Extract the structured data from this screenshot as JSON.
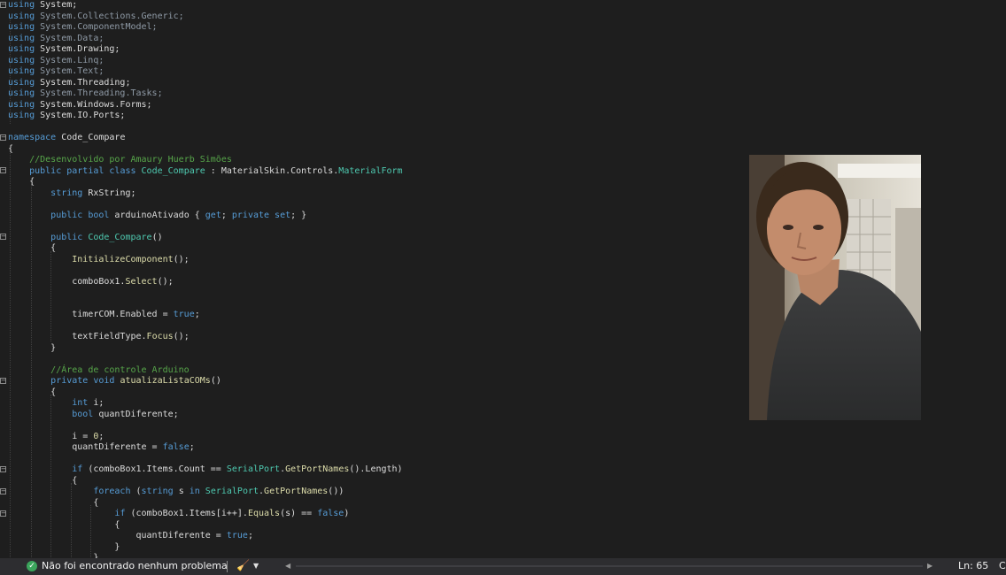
{
  "code_lines": [
    [
      [
        "kw",
        "using "
      ],
      [
        "id",
        "System;"
      ]
    ],
    [
      [
        "kw",
        "using "
      ],
      [
        "dim",
        "System.Collections.Generic;"
      ]
    ],
    [
      [
        "kw",
        "using "
      ],
      [
        "dim",
        "System.ComponentModel;"
      ]
    ],
    [
      [
        "kw",
        "using "
      ],
      [
        "dim",
        "System.Data;"
      ]
    ],
    [
      [
        "kw",
        "using "
      ],
      [
        "id",
        "System.Drawing;"
      ]
    ],
    [
      [
        "kw",
        "using "
      ],
      [
        "dim",
        "System.Linq;"
      ]
    ],
    [
      [
        "kw",
        "using "
      ],
      [
        "dim",
        "System.Text;"
      ]
    ],
    [
      [
        "kw",
        "using "
      ],
      [
        "id",
        "System.Threading;"
      ]
    ],
    [
      [
        "kw",
        "using "
      ],
      [
        "dim",
        "System.Threading.Tasks;"
      ]
    ],
    [
      [
        "kw",
        "using "
      ],
      [
        "id",
        "System.Windows.Forms;"
      ]
    ],
    [
      [
        "kw",
        "using "
      ],
      [
        "id",
        "System.IO.Ports;"
      ]
    ],
    [],
    [
      [
        "kw",
        "namespace "
      ],
      [
        "id",
        "Code_Compare"
      ]
    ],
    [
      [
        "id",
        "{"
      ]
    ],
    [
      [
        "id",
        "    "
      ],
      [
        "cm",
        "//Desenvolvido por Amaury Huerb Simões"
      ]
    ],
    [
      [
        "id",
        "    "
      ],
      [
        "kw",
        "public partial class "
      ],
      [
        "ty",
        "Code_Compare"
      ],
      [
        "id",
        " : MaterialSkin.Controls."
      ],
      [
        "ty",
        "MaterialForm"
      ]
    ],
    [
      [
        "id",
        "    {"
      ]
    ],
    [
      [
        "id",
        "        "
      ],
      [
        "kw",
        "string "
      ],
      [
        "id",
        "RxString;"
      ]
    ],
    [],
    [
      [
        "id",
        "        "
      ],
      [
        "kw",
        "public bool "
      ],
      [
        "id",
        "arduinoAtivado { "
      ],
      [
        "kw",
        "get"
      ],
      [
        "id",
        "; "
      ],
      [
        "kw",
        "private set"
      ],
      [
        "id",
        "; }"
      ]
    ],
    [],
    [
      [
        "id",
        "        "
      ],
      [
        "kw",
        "public "
      ],
      [
        "ty",
        "Code_Compare"
      ],
      [
        "id",
        "()"
      ]
    ],
    [
      [
        "id",
        "        {"
      ]
    ],
    [
      [
        "id",
        "            "
      ],
      [
        "me",
        "InitializeComponent"
      ],
      [
        "id",
        "();"
      ]
    ],
    [],
    [
      [
        "id",
        "            comboBox1."
      ],
      [
        "me",
        "Select"
      ],
      [
        "id",
        "();"
      ]
    ],
    [],
    [],
    [
      [
        "id",
        "            timerCOM.Enabled = "
      ],
      [
        "kw",
        "true"
      ],
      [
        "id",
        ";"
      ]
    ],
    [],
    [
      [
        "id",
        "            textFieldType."
      ],
      [
        "me",
        "Focus"
      ],
      [
        "id",
        "();"
      ]
    ],
    [
      [
        "id",
        "        }"
      ]
    ],
    [],
    [
      [
        "id",
        "        "
      ],
      [
        "cm",
        "//Área de controle Arduino"
      ]
    ],
    [
      [
        "id",
        "        "
      ],
      [
        "kw",
        "private void "
      ],
      [
        "me",
        "atualizaListaCOMs"
      ],
      [
        "id",
        "()"
      ]
    ],
    [
      [
        "id",
        "        {"
      ]
    ],
    [
      [
        "id",
        "            "
      ],
      [
        "kw",
        "int "
      ],
      [
        "id",
        "i;"
      ]
    ],
    [
      [
        "id",
        "            "
      ],
      [
        "kw",
        "bool "
      ],
      [
        "id",
        "quantDiferente;"
      ]
    ],
    [],
    [
      [
        "id",
        "            i = "
      ],
      [
        "me",
        "0"
      ],
      [
        "id",
        ";"
      ]
    ],
    [
      [
        "id",
        "            quantDiferente = "
      ],
      [
        "kw",
        "false"
      ],
      [
        "id",
        ";"
      ]
    ],
    [],
    [
      [
        "id",
        "            "
      ],
      [
        "kw",
        "if "
      ],
      [
        "id",
        "(comboBox1.Items.Count == "
      ],
      [
        "ty",
        "SerialPort"
      ],
      [
        "id",
        "."
      ],
      [
        "me",
        "GetPortNames"
      ],
      [
        "id",
        "().Length)"
      ]
    ],
    [
      [
        "id",
        "            {"
      ]
    ],
    [
      [
        "id",
        "                "
      ],
      [
        "kw",
        "foreach "
      ],
      [
        "id",
        "("
      ],
      [
        "kw",
        "string "
      ],
      [
        "id",
        "s "
      ],
      [
        "kw",
        "in "
      ],
      [
        "ty",
        "SerialPort"
      ],
      [
        "id",
        "."
      ],
      [
        "me",
        "GetPortNames"
      ],
      [
        "id",
        "())"
      ]
    ],
    [
      [
        "id",
        "                {"
      ]
    ],
    [
      [
        "id",
        "                    "
      ],
      [
        "kw",
        "if "
      ],
      [
        "id",
        "(comboBox1.Items[i++]."
      ],
      [
        "me",
        "Equals"
      ],
      [
        "id",
        "(s) == "
      ],
      [
        "kw",
        "false"
      ],
      [
        "id",
        ")"
      ]
    ],
    [
      [
        "id",
        "                    {"
      ]
    ],
    [
      [
        "id",
        "                        quantDiferente = "
      ],
      [
        "kw",
        "true"
      ],
      [
        "id",
        ";"
      ]
    ],
    [
      [
        "id",
        "                    }"
      ]
    ],
    [
      [
        "id",
        "                }"
      ]
    ]
  ],
  "statusbar": {
    "status_icon": "check-circle-icon",
    "status_text": "Não foi encontrado nenhum problema",
    "brush_icon": "cleanup-brush-icon",
    "line_indicator": "Ln: 65",
    "col_indicator": "C"
  },
  "colors": {
    "editor_bg": "#1e1e1e",
    "keyword": "#569cd6",
    "type": "#4ec9b0",
    "method": "#dcdcaa",
    "comment": "#57a64a",
    "status_ok": "#3ba55c"
  }
}
